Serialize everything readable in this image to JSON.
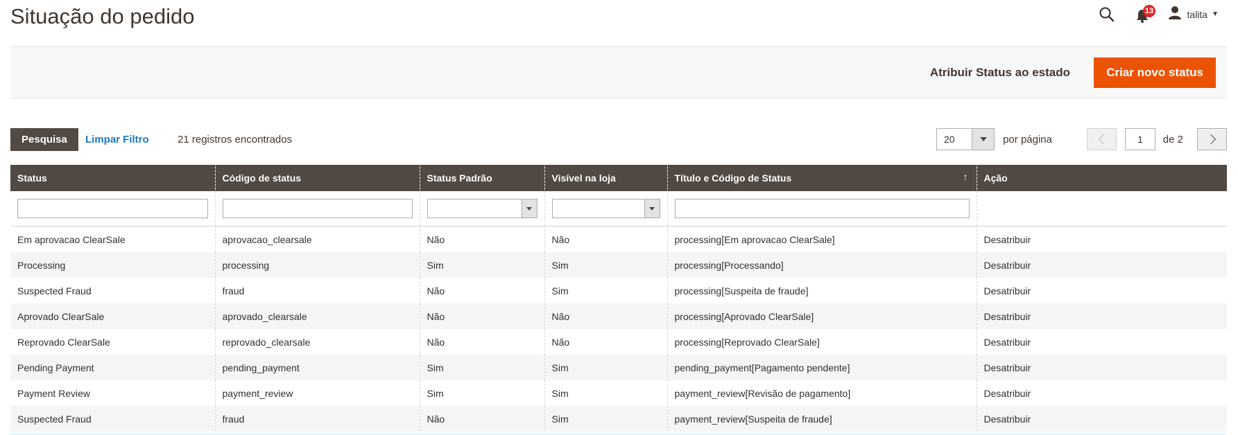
{
  "page": {
    "title": "Situação do pedido"
  },
  "header": {
    "notifications_count": "13",
    "user_name": "talita"
  },
  "actions": {
    "assign_label": "Atribuir Status ao estado",
    "create_label": "Criar novo status"
  },
  "toolbar": {
    "search_label": "Pesquisa",
    "reset_label": "Limpar Filtro",
    "records": "21 registros encontrados",
    "per_page_value": "20",
    "per_page_label": "por página",
    "current_page": "1",
    "page_of": "de 2"
  },
  "grid": {
    "columns": [
      "Status",
      "Código de status",
      "Status Padrão",
      "Visível na loja",
      "Título e Código de Status",
      "Ação"
    ],
    "sort_indicator": "↑",
    "rows": [
      {
        "status": "Em aprovacao ClearSale",
        "code": "aprovacao_clearsale",
        "default": "Não",
        "visible": "Não",
        "title": "processing[Em aprovacao ClearSale]",
        "action": "Desatribuir"
      },
      {
        "status": "Processing",
        "code": "processing",
        "default": "Sim",
        "visible": "Sim",
        "title": "processing[Processando]",
        "action": "Desatribuir"
      },
      {
        "status": "Suspected Fraud",
        "code": "fraud",
        "default": "Não",
        "visible": "Sim",
        "title": "processing[Suspeita de fraude]",
        "action": "Desatribuir"
      },
      {
        "status": "Aprovado ClearSale",
        "code": "aprovado_clearsale",
        "default": "Não",
        "visible": "Não",
        "title": "processing[Aprovado ClearSale]",
        "action": "Desatribuir"
      },
      {
        "status": "Reprovado ClearSale",
        "code": "reprovado_clearsale",
        "default": "Não",
        "visible": "Não",
        "title": "processing[Reprovado ClearSale]",
        "action": "Desatribuir"
      },
      {
        "status": "Pending Payment",
        "code": "pending_payment",
        "default": "Sim",
        "visible": "Sim",
        "title": "pending_payment[Pagamento pendente]",
        "action": "Desatribuir"
      },
      {
        "status": "Payment Review",
        "code": "payment_review",
        "default": "Sim",
        "visible": "Sim",
        "title": "payment_review[Revisão de pagamento]",
        "action": "Desatribuir"
      },
      {
        "status": "Suspected Fraud",
        "code": "fraud",
        "default": "Não",
        "visible": "Sim",
        "title": "payment_review[Suspeita de fraude]",
        "action": "Desatribuir"
      }
    ]
  },
  "colors": {
    "accent": "#eb5202",
    "header_bg": "#514943",
    "link": "#1979c3",
    "badge": "#e22626"
  }
}
